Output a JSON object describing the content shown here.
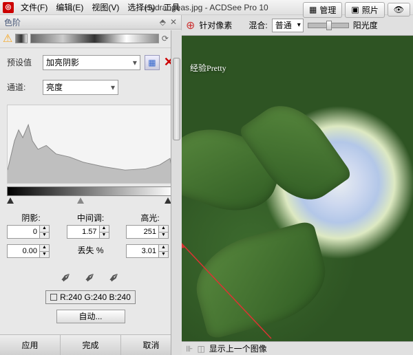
{
  "app": {
    "title": "Hydrangeas.jpg - ACDSee Pro 10"
  },
  "menu": {
    "file": "文件(F)",
    "edit": "编辑(E)",
    "view": "视图(V)",
    "select": "选择(S)",
    "tools": "工具"
  },
  "topbar": {
    "manage": "管理",
    "photo": "照片",
    "eye": "👁"
  },
  "panel": {
    "title": "色阶",
    "preset_label": "预设值",
    "preset_value": "加亮阴影",
    "channel_label": "通道:",
    "channel_value": "亮度",
    "shadow_label": "阴影:",
    "mid_label": "中间调:",
    "highlight_label": "高光:",
    "shadow_val": "0",
    "mid_val": "1.57",
    "highlight_val": "251",
    "out_black": "0.00",
    "loss_label": "丢失  %",
    "out_white": "3.01",
    "rgb_readout": "R:240  G:240  B:240",
    "auto": "自动...",
    "apply": "应用",
    "done": "完成",
    "cancel": "取消"
  },
  "right": {
    "target_label": "针对像素",
    "blend_label": "混合:",
    "blend_value": "普通",
    "exposure_label": "阳光度",
    "status": "显示上一个图像",
    "overlay_cn": "经验",
    "overlay_en": "Pretty"
  }
}
